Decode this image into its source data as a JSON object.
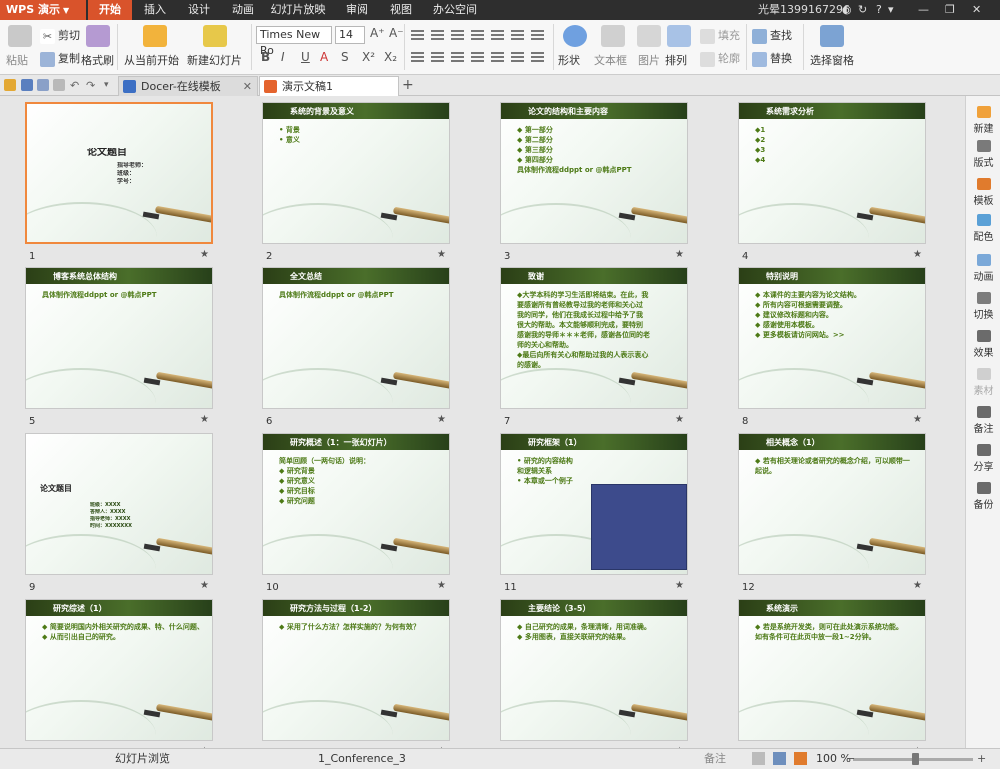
{
  "app": {
    "name": "WPS 演示"
  },
  "menu": {
    "tabs": [
      "开始",
      "插入",
      "设计",
      "动画",
      "幻灯片放映",
      "审阅",
      "视图",
      "办公空间"
    ]
  },
  "user": {
    "name": "光晕1399167296"
  },
  "toolbar": {
    "paste": "粘贴",
    "cut": "剪切",
    "copy": "复制",
    "format_painter": "格式刷",
    "from_current": "从当前开始",
    "new_slide": "新建幻灯片",
    "font_name": "Times New Ro",
    "font_size": "14",
    "shape": "形状",
    "textbox": "文本框",
    "picture": "图片",
    "arrange": "排列",
    "fill": "填充",
    "outline": "轮廓",
    "find": "查找",
    "replace": "替换",
    "select_pane": "选择窗格"
  },
  "tabs": [
    {
      "label": "Docer-在线模板"
    },
    {
      "label": "演示文稿1"
    }
  ],
  "slides": [
    {
      "num": "1",
      "title": "",
      "lines": [
        "论文题目",
        "指导老师：",
        "班级：",
        "学号："
      ],
      "layout": "cover"
    },
    {
      "num": "2",
      "title": "系统的背景及意义",
      "lines": [
        "• 背景",
        "• 意义"
      ]
    },
    {
      "num": "3",
      "title": "论文的结构和主要内容",
      "lines": [
        "◆ 第一部分",
        "◆ 第二部分",
        "◆ 第三部分",
        "◆ 第四部分",
        "",
        "具体制作流程ddppt or @韩点PPT"
      ]
    },
    {
      "num": "4",
      "title": "系统需求分析",
      "lines": [
        "◆1",
        "◆2",
        "◆3",
        "◆4"
      ]
    },
    {
      "num": "5",
      "title": "博客系统总体结构",
      "lines": [
        "",
        "",
        "",
        "具体制作流程ddppt or @韩点PPT"
      ]
    },
    {
      "num": "6",
      "title": "全文总结",
      "lines": [
        "",
        "",
        "",
        "具体制作流程ddppt or @韩点PPT"
      ]
    },
    {
      "num": "7",
      "title": "致谢",
      "lines": [
        "◆大学本科的学习生活即将结束。在此，我",
        "要感谢所有曾经教导过我的老师和关心过",
        "我的同学，他们在我成长过程中给予了我",
        "很大的帮助。本文能够顺利完成，要特别",
        "感谢我的导师＊＊＊老师，感谢各位同的老",
        "师的关心和帮助。",
        "◆最后向所有关心和帮助过我的人表示衷心",
        "的感谢。"
      ]
    },
    {
      "num": "8",
      "title": "特别说明",
      "lines": [
        "◆ 本课件的主要内容为论文结构。",
        "◆ 所有内容可根据需要调整。",
        "◆ 建议修改标题和内容。",
        "◆ 感谢使用本模板。",
        "◆ 更多模板请访问网站。>>"
      ]
    },
    {
      "num": "9",
      "title": "",
      "lines": [
        "论文题目",
        "班级：XXXX",
        "答辩人：XXXX",
        "指导老师：XXXX",
        "时间：XXXXXXX"
      ],
      "layout": "cover2"
    },
    {
      "num": "10",
      "title": "研究概述（1：一张幻灯片）",
      "lines": [
        "简单回顾（一两句话）说明：",
        "◆ 研究背景",
        "◆ 研究意义",
        "◆ 研究目标",
        "◆ 研究问题"
      ]
    },
    {
      "num": "11",
      "title": "研究框架（1）",
      "lines": [
        "• 研究的内容结构",
        "  和逻辑关系",
        "• 本章或一个例子"
      ],
      "layout": "diagram"
    },
    {
      "num": "12",
      "title": "相关概念（1）",
      "lines": [
        "◆ 若有相关理论或者研究的概念介绍，可以顺带一",
        "    起说。"
      ]
    },
    {
      "num": "13",
      "title": "研究综述（1）",
      "lines": [
        "◆ 简要说明国内外相关研究的成果、特、什么问题、什么成果",
        "◆ 从而引出自己的研究。"
      ]
    },
    {
      "num": "14",
      "title": "研究方法与过程（1-2）",
      "lines": [
        "◆ 采用了什么方法？怎样实施的？为何有效？"
      ]
    },
    {
      "num": "15",
      "title": "主要结论（3-5）",
      "lines": [
        "◆ 自己研究的成果，条理清晰，用词准确。",
        "◆ 多用图表，直接关联研究的结果。"
      ]
    },
    {
      "num": "16",
      "title": "系统演示",
      "lines": [
        "◆ 若是系统开发类，则可在此处演示系统功能。",
        "    如有条件可在此页中放一段1~2分钟。"
      ]
    }
  ],
  "right_panel": [
    "新建",
    "版式",
    "模板",
    "配色",
    "动画",
    "切换",
    "效果",
    "素材",
    "备注",
    "分享",
    "备份"
  ],
  "status": {
    "view": "幻灯片浏览",
    "template": "1_Conference_3",
    "notes": "备注",
    "zoom": "100 %"
  }
}
